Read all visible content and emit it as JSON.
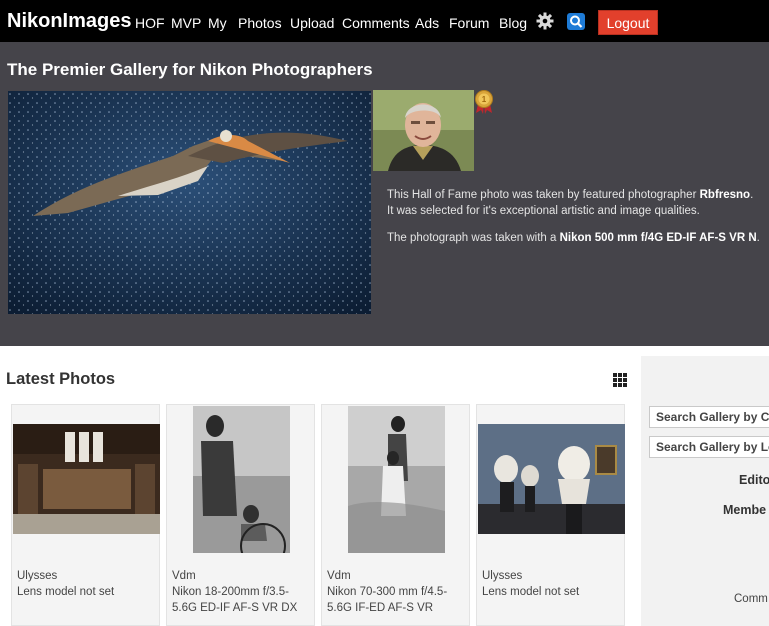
{
  "brand": "NikonImages",
  "nav": {
    "hof": "HOF",
    "mvp": "MVP",
    "my": "My",
    "photos": "Photos",
    "upload": "Upload",
    "comments": "Comments",
    "ads": "Ads",
    "forum": "Forum",
    "blog": "Blog",
    "logout": "Logout"
  },
  "hero": {
    "title": "The Premier Gallery for Nikon Photographers",
    "line1_prefix": "This Hall of Fame photo was taken by featured photographer ",
    "photographer": "Rbfresno",
    "line1_suffix": ".",
    "line2": "It was selected for it's exceptional artistic and image qualities.",
    "line3_prefix": "The photograph was taken with a ",
    "lens": "Nikon 500 mm f/4G ED-IF AF-S VR N",
    "line3_suffix": "."
  },
  "latest": {
    "title": "Latest Photos",
    "photos": [
      {
        "user": "Ulysses",
        "lens": "Lens model not set"
      },
      {
        "user": "Vdm",
        "lens": "Nikon 18-200mm f/3.5-5.6G ED-IF AF-S VR DX"
      },
      {
        "user": "Vdm",
        "lens": "Nikon 70-300 mm f/4.5-5.6G IF-ED AF-S VR"
      },
      {
        "user": "Ulysses",
        "lens": "Lens model not set"
      }
    ]
  },
  "sidebar": {
    "search_category": "Search Gallery by Ca",
    "search_lens": "Search Gallery by Le",
    "editors": "Edito",
    "members": "Membe",
    "comments": "Comm"
  },
  "colors": {
    "nav_bg": "#000000",
    "hero_bg": "#45444a",
    "logout_bg": "#e2402c",
    "search_blue": "#1e7bd6"
  },
  "icons": [
    "gear-icon",
    "search-icon",
    "medal-icon",
    "grid-view-icon"
  ]
}
